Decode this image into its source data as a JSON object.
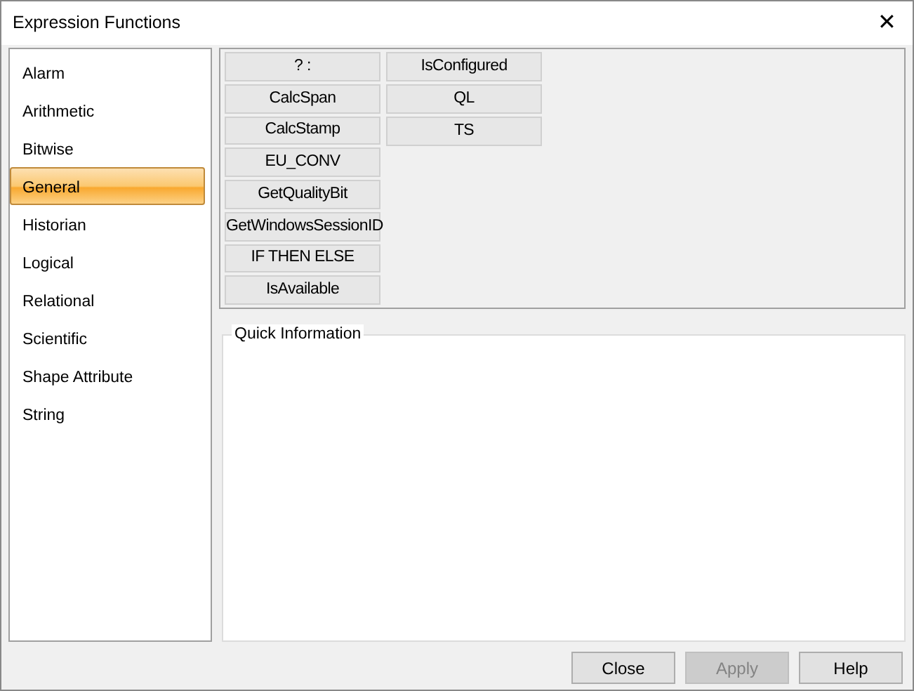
{
  "window": {
    "title": "Expression Functions",
    "close": "✕"
  },
  "categories": [
    {
      "label": "Alarm",
      "selected": false
    },
    {
      "label": "Arithmetic",
      "selected": false
    },
    {
      "label": "Bitwise",
      "selected": false
    },
    {
      "label": "General",
      "selected": true
    },
    {
      "label": "Historian",
      "selected": false
    },
    {
      "label": "Logical",
      "selected": false
    },
    {
      "label": "Relational",
      "selected": false
    },
    {
      "label": "Scientific",
      "selected": false
    },
    {
      "label": "Shape Attribute",
      "selected": false
    },
    {
      "label": "String",
      "selected": false
    }
  ],
  "functions": [
    [
      "? :",
      "CalcSpan",
      "CalcStamp",
      "EU_CONV",
      "GetQualityBit",
      "GetWindowsSessionID",
      "IF THEN ELSE",
      "IsAvailable"
    ],
    [
      "IsConfigured",
      "QL",
      "TS"
    ]
  ],
  "quick_information": {
    "title": "Quick Information"
  },
  "buttons": [
    {
      "label": "Close",
      "disabled": false
    },
    {
      "label": "Apply",
      "disabled": true
    },
    {
      "label": "Help",
      "disabled": false
    }
  ]
}
